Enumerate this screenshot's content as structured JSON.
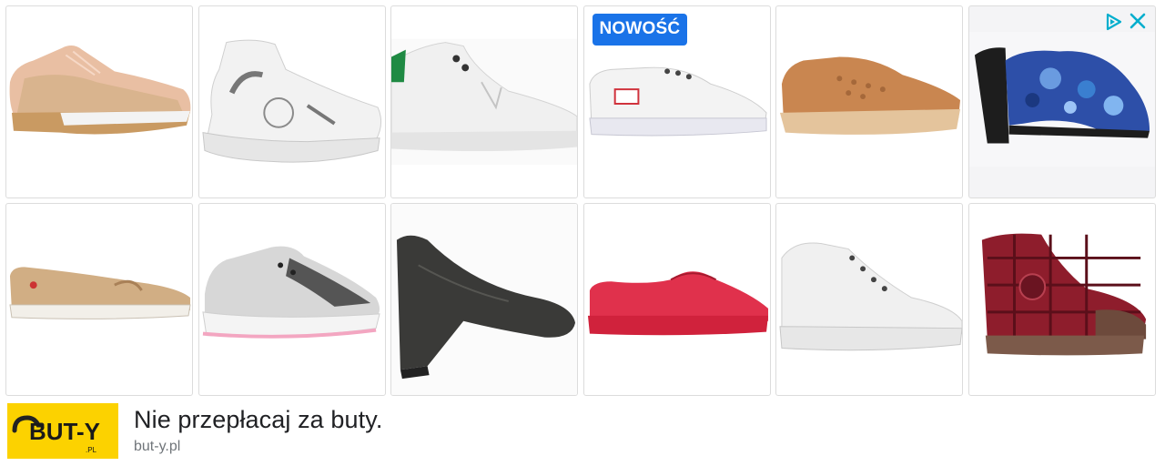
{
  "ad": {
    "badge_text": "NOWOŚĆ",
    "headline": "Nie przepłacaj za buty.",
    "domain": "but-y.pl",
    "logo_text": "BUT-Y",
    "logo_suffix": ".PL",
    "badge_color": "#1a73e8",
    "logo_color": "#fcd200",
    "adchoices_icon": "adchoices-triangle-icon",
    "close_icon": "close-x-icon"
  },
  "products": [
    {
      "label": "peach-sneaker"
    },
    {
      "label": "white-chunky-sneaker"
    },
    {
      "label": "white-high-top-green-tab"
    },
    {
      "label": "white-lace-sneaker-with-badge"
    },
    {
      "label": "tan-perforated-sneaker"
    },
    {
      "label": "blue-floral-mule"
    },
    {
      "label": "gold-loafer"
    },
    {
      "label": "white-pink-running-shoe"
    },
    {
      "label": "black-wedge-pump"
    },
    {
      "label": "red-slip-on"
    },
    {
      "label": "white-wedge-sneaker"
    },
    {
      "label": "red-plaid-high-top"
    }
  ]
}
